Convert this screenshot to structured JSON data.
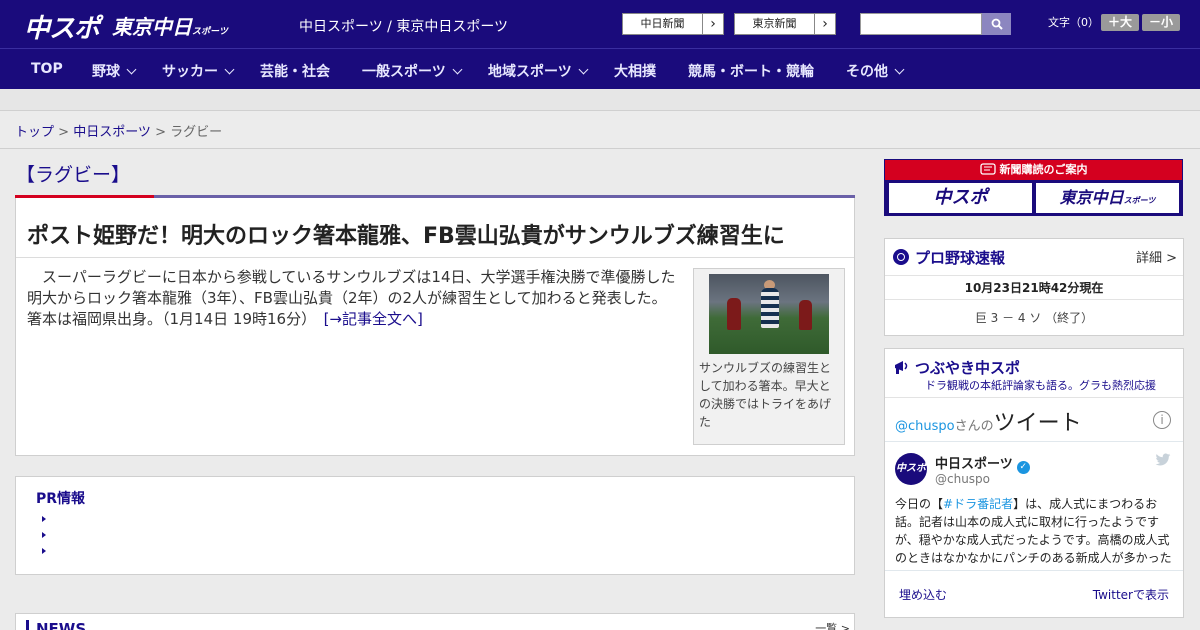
{
  "header": {
    "logo_chuspo": "中スポ",
    "logo_tokyo": "東京中日",
    "logo_tokyo_small": "スポーツ",
    "site_names": "中日スポーツ / 東京中日スポーツ",
    "paper_links": [
      {
        "label": "中日新聞",
        "arrow": "›"
      },
      {
        "label": "東京新聞",
        "arrow": "›"
      }
    ],
    "search_placeholder": "",
    "font_size_label": "文字（0）",
    "font_larger": "＋大",
    "font_smaller": "－小"
  },
  "nav": {
    "items": [
      {
        "label": "TOP",
        "has_menu": false
      },
      {
        "label": "野球",
        "has_menu": true
      },
      {
        "label": "サッカー",
        "has_menu": true
      },
      {
        "label": "芸能・社会",
        "has_menu": false
      },
      {
        "label": "一般スポーツ",
        "has_menu": true
      },
      {
        "label": "地域スポーツ",
        "has_menu": true
      },
      {
        "label": "大相撲",
        "has_menu": false
      },
      {
        "label": "競馬・ボート・競輪",
        "has_menu": false
      },
      {
        "label": "その他",
        "has_menu": true
      }
    ]
  },
  "breadcrumb": {
    "top": "トップ",
    "sep1": " > ",
    "section": "中日スポーツ",
    "sep2": " > ",
    "current": "ラグビー"
  },
  "article": {
    "section_title": "【ラグビー】",
    "headline": "ポスト姫野だ！明大のロック箸本龍雅、FB雲山弘貴がサンウルブズ練習生に",
    "body": "　スーパーラグビーに日本から参戦しているサンウルブズは14日、大学選手権決勝で準優勝した明大からロック箸本龍雅（3年）、FB雲山弘貴（2年）の2人が練習生として加わると発表した。　箸本は福岡県出身。（1月14日 19時16分）　",
    "read_more": "[→記事全文へ]",
    "photo_caption": "サンウルブズの練習生として加わる箸本。早大との決勝ではトライをあげた"
  },
  "pr": {
    "title": "PR情報",
    "items": [
      "",
      "",
      ""
    ]
  },
  "news": {
    "title": "NEWS",
    "more": "一覧 >"
  },
  "sidebar": {
    "subscribe": {
      "title": "新聞購読のご案内",
      "logo_a": "中スポ",
      "logo_b": "東京中日",
      "logo_b_small": "スポーツ"
    },
    "baseball": {
      "title": "プロ野球速報",
      "detail": "詳細 >",
      "timestamp": "10月23日21時42分現在",
      "score": "巨  3 － 4  ソ  （終了）"
    },
    "twitter": {
      "title": "つぶやき中スポ",
      "subtitle": "ドラ観戦の本紙評論家も語る。グラも熱烈応援",
      "handle_prefix": "@chuspo",
      "handle_suffix": "さんの",
      "tweets_label": "ツイート",
      "account_name": "中日スポーツ",
      "account_handle": "@chuspo",
      "avatar_text": "中スポ",
      "tweet_before": "今日の【",
      "tweet_tag": "#ドラ番記者",
      "tweet_after": "】は、成人式にまつわるお話。記者は山本の成人式に取材に行ったようですが、穏やかな成人式だったようです。高橋の成人式のときはなかなかにパンチのある新成人が多かった",
      "embed_label": "埋め込む",
      "view_label": "Twitterで表示"
    }
  },
  "colors": {
    "brand_navy": "#1a0b7c",
    "accent_red": "#d4001f",
    "link": "#1a0d8c",
    "twitter_blue": "#1b95e0"
  }
}
